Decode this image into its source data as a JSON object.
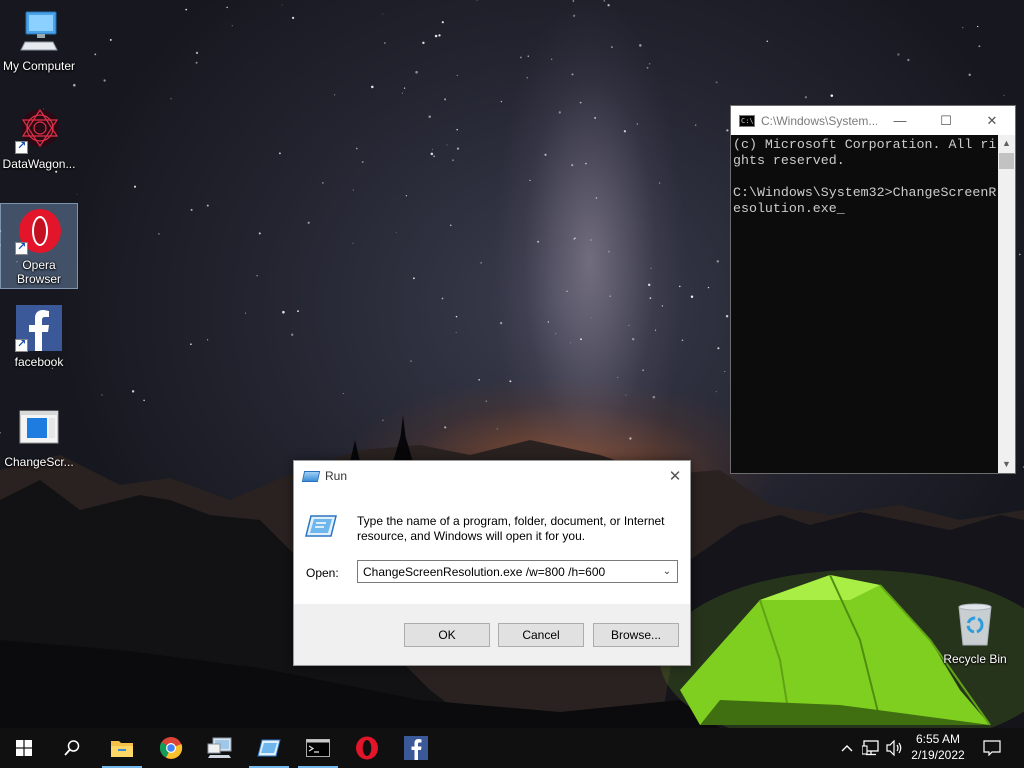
{
  "desktop": {
    "icons": [
      {
        "label": "My Computer"
      },
      {
        "label": "DataWagon..."
      },
      {
        "label": "Opera Browser"
      },
      {
        "label": "facebook"
      },
      {
        "label": "ChangeScr..."
      },
      {
        "label": "Recycle Bin"
      }
    ]
  },
  "cmd_window": {
    "title": "C:\\Windows\\System...",
    "lines": [
      "(c) Microsoft Corporation. All ri",
      "ghts reserved.",
      "",
      "C:\\Windows\\System32>ChangeScreenR",
      "esolution.exe_"
    ]
  },
  "run_dialog": {
    "title": "Run",
    "description": "Type the name of a program, folder, document, or Internet resource, and Windows will open it for you.",
    "open_label": "Open:",
    "open_value": "ChangeScreenResolution.exe /w=800 /h=600",
    "ok_label": "OK",
    "cancel_label": "Cancel",
    "browse_label": "Browse..."
  },
  "taskbar": {
    "pinned": [
      "start-icon",
      "search-icon",
      "file-explorer-icon",
      "chrome-icon",
      "network-computer-icon",
      "run-icon",
      "cmd-icon",
      "opera-icon",
      "facebook-icon"
    ],
    "tray": [
      "chevron-up-icon",
      "network-icon",
      "volume-icon"
    ],
    "time": "6:55 AM",
    "date": "2/19/2022"
  },
  "colors": {
    "taskbar": "#101010",
    "accent": "#76b9ed",
    "console_bg": "#0c0c0c",
    "console_text": "#cccccc",
    "tent": "#8fdc2a"
  }
}
